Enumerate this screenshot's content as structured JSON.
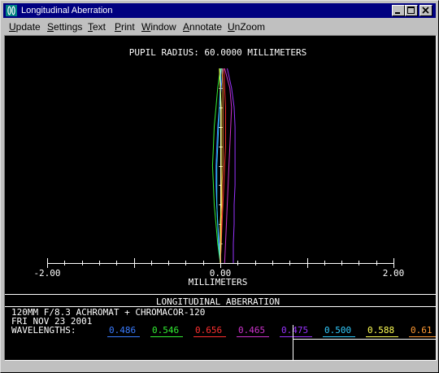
{
  "window": {
    "title": "Longitudinal Aberration"
  },
  "menu": {
    "items": [
      "Update",
      "Settings",
      "Text",
      "Print",
      "Window",
      "Annotate",
      "UnZoom"
    ]
  },
  "plot": {
    "header": "PUPIL RADIUS: 60.0000 MILLIMETERS",
    "section_title": "LONGITUDINAL ABERRATION",
    "info_lines": [
      "120MM F/8.3  ACHROMAT + CHROMACOR-120",
      "FRI NOV 23 2001"
    ],
    "wavelengths_label": "WAVELENGTHS:"
  },
  "chart_data": {
    "type": "line",
    "xlabel": "MILLIMETERS",
    "xlim": [
      -2.0,
      2.0
    ],
    "x_tick_labels": [
      "-2.00",
      "0.00",
      "2.00"
    ],
    "ylim": [
      0,
      1
    ],
    "series": [
      {
        "name": "0.486",
        "color": "#3a7cff",
        "x": [
          0.0,
          -0.01,
          -0.03,
          -0.04,
          -0.05,
          -0.05,
          -0.04,
          -0.03,
          -0.01,
          0.01,
          0.03
        ],
        "y": [
          0.0,
          0.1,
          0.2,
          0.3,
          0.4,
          0.5,
          0.6,
          0.7,
          0.8,
          0.9,
          1.0
        ]
      },
      {
        "name": "0.546",
        "color": "#33ee33",
        "x": [
          0.0,
          -0.03,
          -0.05,
          -0.07,
          -0.08,
          -0.09,
          -0.08,
          -0.07,
          -0.05,
          -0.03,
          0.0
        ],
        "y": [
          0.0,
          0.1,
          0.2,
          0.3,
          0.4,
          0.5,
          0.6,
          0.7,
          0.8,
          0.9,
          1.0
        ]
      },
      {
        "name": "0.656",
        "color": "#ff3030",
        "x": [
          0.0,
          0.01,
          0.02,
          0.03,
          0.04,
          0.05,
          0.06,
          0.06,
          0.06,
          0.05,
          0.04
        ],
        "y": [
          0.0,
          0.1,
          0.2,
          0.3,
          0.4,
          0.5,
          0.6,
          0.7,
          0.8,
          0.9,
          1.0
        ]
      },
      {
        "name": "0.465",
        "color": "#cc33cc",
        "x": [
          0.05,
          0.06,
          0.07,
          0.08,
          0.09,
          0.1,
          0.11,
          0.12,
          0.13,
          0.11,
          0.05
        ],
        "y": [
          0.0,
          0.1,
          0.2,
          0.3,
          0.4,
          0.5,
          0.6,
          0.7,
          0.8,
          0.9,
          1.0
        ]
      },
      {
        "name": "0.475",
        "color": "#9933ff",
        "x": [
          0.15,
          0.15,
          0.16,
          0.16,
          0.17,
          0.17,
          0.17,
          0.17,
          0.16,
          0.13,
          0.08
        ],
        "y": [
          0.0,
          0.1,
          0.2,
          0.3,
          0.4,
          0.5,
          0.6,
          0.7,
          0.8,
          0.9,
          1.0
        ]
      },
      {
        "name": "0.500",
        "color": "#33ccff",
        "x": [
          0.0,
          -0.02,
          -0.03,
          -0.04,
          -0.04,
          -0.04,
          -0.03,
          -0.02,
          -0.01,
          0.0,
          0.01
        ],
        "y": [
          0.0,
          0.1,
          0.2,
          0.3,
          0.4,
          0.5,
          0.6,
          0.7,
          0.8,
          0.9,
          1.0
        ]
      },
      {
        "name": "0.588",
        "color": "#ffff55",
        "x": [
          0.0,
          0.0,
          0.0,
          0.01,
          0.01,
          0.01,
          0.01,
          0.01,
          0.01,
          0.0,
          -0.01
        ],
        "y": [
          0.0,
          0.1,
          0.2,
          0.3,
          0.4,
          0.5,
          0.6,
          0.7,
          0.8,
          0.9,
          1.0
        ]
      },
      {
        "name": "0.61",
        "color": "#ff9933",
        "x": [
          0.0,
          0.01,
          0.01,
          0.02,
          0.02,
          0.03,
          0.03,
          0.03,
          0.03,
          0.03,
          0.02
        ],
        "y": [
          0.0,
          0.1,
          0.2,
          0.3,
          0.4,
          0.5,
          0.6,
          0.7,
          0.8,
          0.9,
          1.0
        ]
      }
    ]
  },
  "colors": {
    "titlebar": "#000080",
    "plot_background": "#000000",
    "plot_foreground": "#ffffff",
    "chrome": "#c0c0c0"
  }
}
